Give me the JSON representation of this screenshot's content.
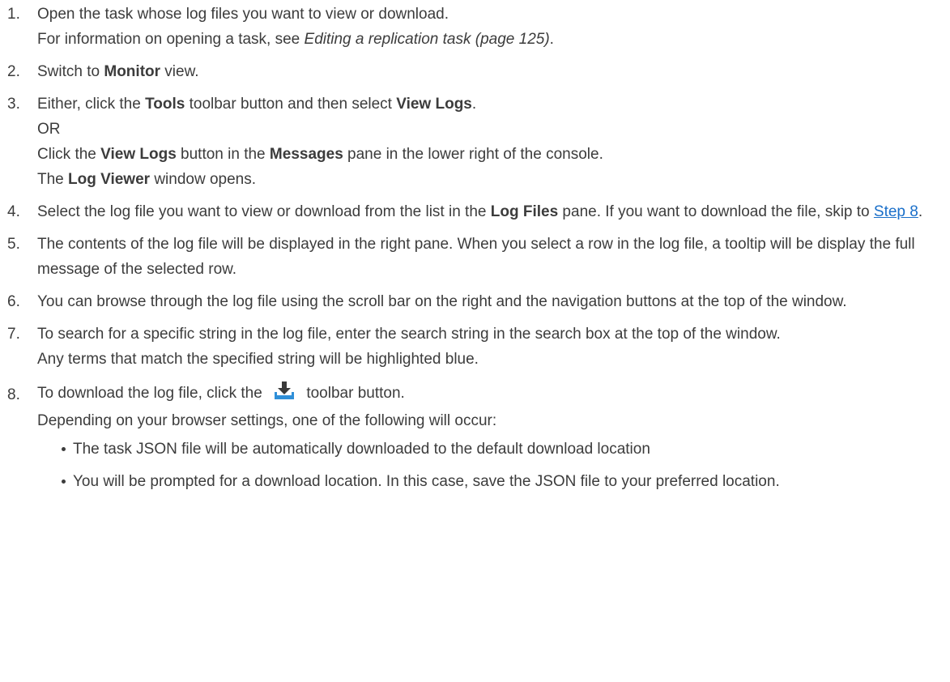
{
  "steps": [
    {
      "num": "1.",
      "line1": "Open the task whose log files you want to view or download.",
      "line2_a": "For information on opening a task, see ",
      "line2_ref": "Editing a replication task (page 125)",
      "line2_b": "."
    },
    {
      "num": "2.",
      "a": "Switch to ",
      "bold": "Monitor",
      "b": " view."
    },
    {
      "num": "3.",
      "l1_a": "Either, click the ",
      "l1_bold1": "Tools",
      "l1_b": " toolbar button and then select ",
      "l1_bold2": "View Logs",
      "l1_c": ".",
      "l2": "OR",
      "l3_a": "Click the ",
      "l3_bold1": "View Logs",
      "l3_b": " button in the ",
      "l3_bold2": "Messages",
      "l3_c": " pane in the lower right of the console.",
      "l4_a": "The ",
      "l4_bold": "Log Viewer",
      "l4_b": " window opens."
    },
    {
      "num": "4.",
      "a": "Select the log file you want to view or download from the list in the ",
      "bold": "Log Files",
      "b": " pane. If you want to download the file, skip to ",
      "link": "Step 8",
      "c": "."
    },
    {
      "num": "5.",
      "text": "The contents of the log file will be displayed in the right pane. When you select a row in the log file, a tooltip will be display the full message of the selected row."
    },
    {
      "num": "6.",
      "text": "You can browse through the log file using the scroll bar on the right and the navigation buttons at the top of the window."
    },
    {
      "num": "7.",
      "text": "To search for a specific string in the log file, enter the search string in the search box at the top of the window.",
      "text2": "Any terms that match the specified string will be highlighted blue."
    },
    {
      "num": "8.",
      "a": "To download the log file, click the ",
      "icon": "download-icon",
      "b": " toolbar button.",
      "line2": "Depending on your browser settings, one of the following will occur:",
      "bullets": [
        "The task JSON file will be automatically downloaded to the default download location",
        "You will be prompted for a download location. In this case, save the JSON file to your preferred location."
      ]
    }
  ],
  "colors": {
    "text": "#3c3c3c",
    "link": "#1a6fc9",
    "icon_arrow": "#3a3a3a",
    "icon_tray": "#2f8fd8"
  }
}
